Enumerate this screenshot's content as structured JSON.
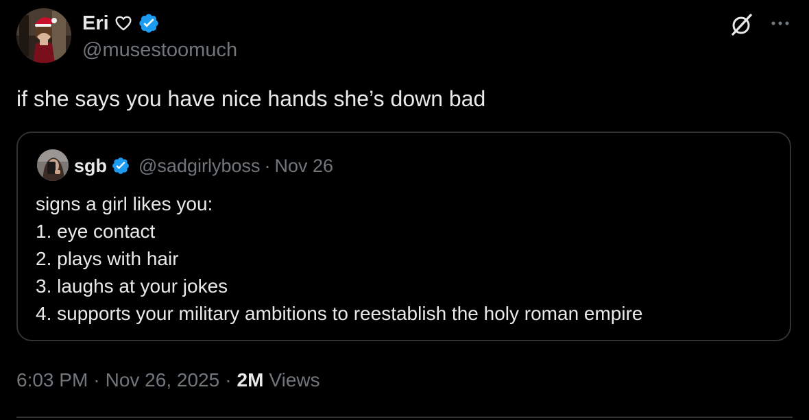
{
  "author": {
    "display_name": "Eri",
    "handle": "@musestoomuch",
    "name_emoji_icon": "heart-outline-icon",
    "verified": true
  },
  "tweet": {
    "text": "if she says you have nice hands she’s down bad"
  },
  "quoted_tweet": {
    "display_name": "sgb",
    "handle": "@sadgirlyboss",
    "separator": "·",
    "date": "Nov 26",
    "verified": true,
    "lines": [
      "signs a girl likes you:",
      "1. eye contact",
      "2. plays with hair",
      "3. laughs at your jokes",
      "4. supports your military ambitions to reestablish the holy roman empire"
    ]
  },
  "meta": {
    "time": "6:03 PM",
    "separator1": "·",
    "date": "Nov 26, 2025",
    "separator2": "·",
    "views_count": "2M",
    "views_label": "Views"
  },
  "icons": {
    "grok": "grok-icon",
    "more": "more-horizontal-icon",
    "verified": "verified-badge-icon"
  },
  "colors": {
    "background": "#000000",
    "text_primary": "#e7e9ea",
    "text_secondary": "#71767b",
    "border": "#2f3336",
    "verified_blue": "#1d9bf0"
  }
}
